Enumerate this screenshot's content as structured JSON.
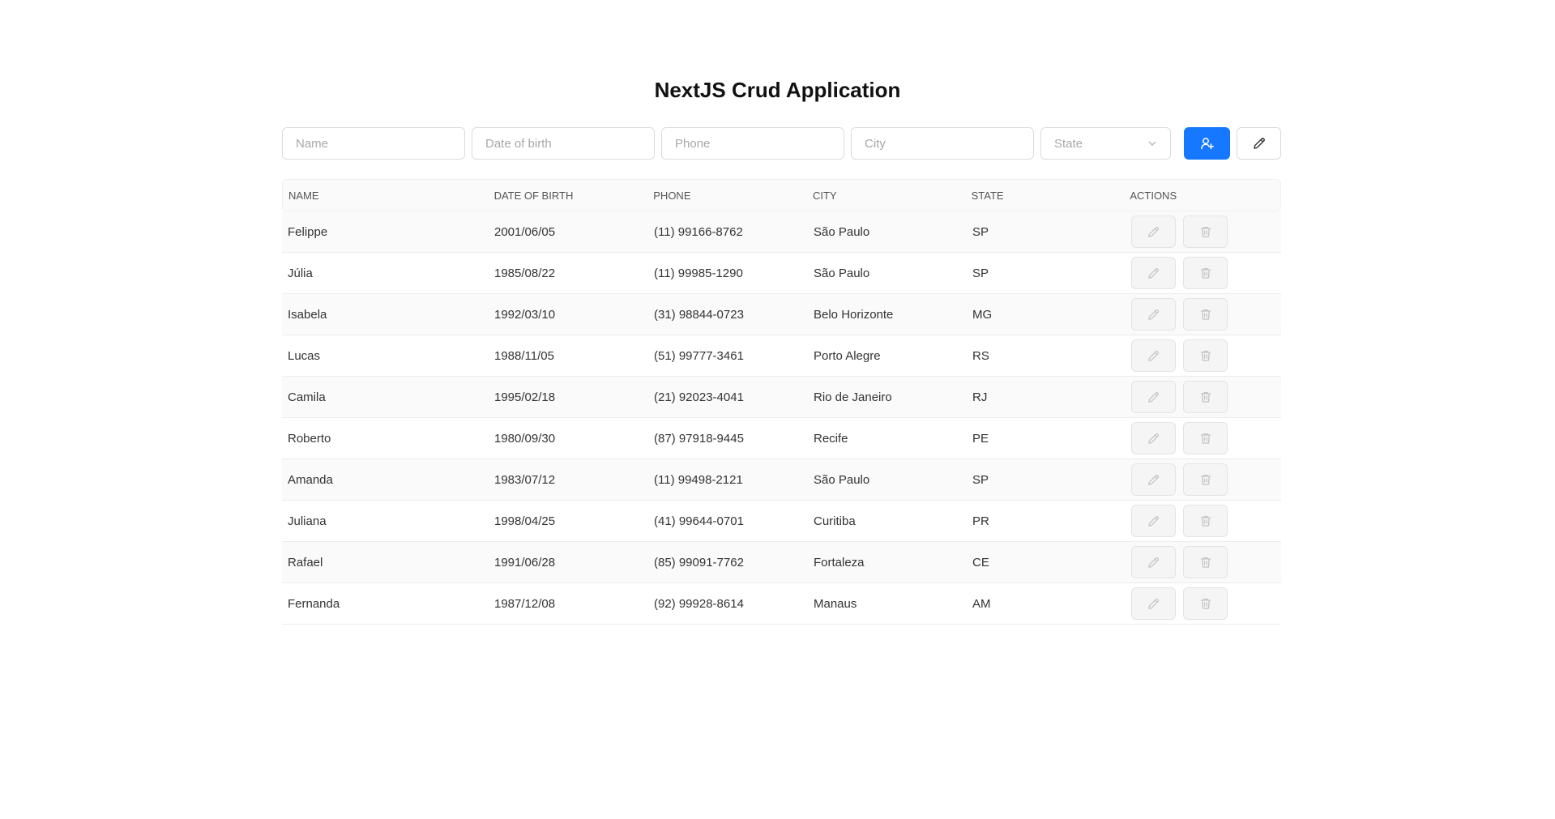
{
  "header": {
    "title": "NextJS Crud Application"
  },
  "form": {
    "name_placeholder": "Name",
    "dob_placeholder": "Date of birth",
    "phone_placeholder": "Phone",
    "city_placeholder": "City",
    "state_placeholder": "State",
    "add_button_icon": "user-add-icon",
    "edit_button_icon": "edit-icon"
  },
  "table": {
    "columns": [
      "Name",
      "Date of birth",
      "Phone",
      "City",
      "State",
      "Actions"
    ],
    "rows": [
      {
        "name": "Felippe",
        "dob": "2001/06/05",
        "phone": "(11) 99166-8762",
        "city": "São Paulo",
        "state": "SP"
      },
      {
        "name": "Júlia",
        "dob": "1985/08/22",
        "phone": "(11) 99985-1290",
        "city": "São Paulo",
        "state": "SP"
      },
      {
        "name": "Isabela",
        "dob": "1992/03/10",
        "phone": "(31) 98844-0723",
        "city": "Belo Horizonte",
        "state": "MG"
      },
      {
        "name": "Lucas",
        "dob": "1988/11/05",
        "phone": "(51) 99777-3461",
        "city": "Porto Alegre",
        "state": "RS"
      },
      {
        "name": "Camila",
        "dob": "1995/02/18",
        "phone": "(21) 92023-4041",
        "city": "Rio de Janeiro",
        "state": "RJ"
      },
      {
        "name": "Roberto",
        "dob": "1980/09/30",
        "phone": "(87) 97918-9445",
        "city": "Recife",
        "state": "PE"
      },
      {
        "name": "Amanda",
        "dob": "1983/07/12",
        "phone": "(11) 99498-2121",
        "city": "São Paulo",
        "state": "SP"
      },
      {
        "name": "Juliana",
        "dob": "1998/04/25",
        "phone": "(41) 99644-0701",
        "city": "Curitiba",
        "state": "PR"
      },
      {
        "name": "Rafael",
        "dob": "1991/06/28",
        "phone": "(85) 99091-7762",
        "city": "Fortaleza",
        "state": "CE"
      },
      {
        "name": "Fernanda",
        "dob": "1987/12/08",
        "phone": "(92) 99928-8614",
        "city": "Manaus",
        "state": "AM"
      }
    ],
    "row_action_icons": [
      "edit-icon",
      "delete-icon"
    ]
  },
  "colors": {
    "primary": "#1677ff",
    "header_bg": "#fafafa",
    "border": "#ececec"
  }
}
